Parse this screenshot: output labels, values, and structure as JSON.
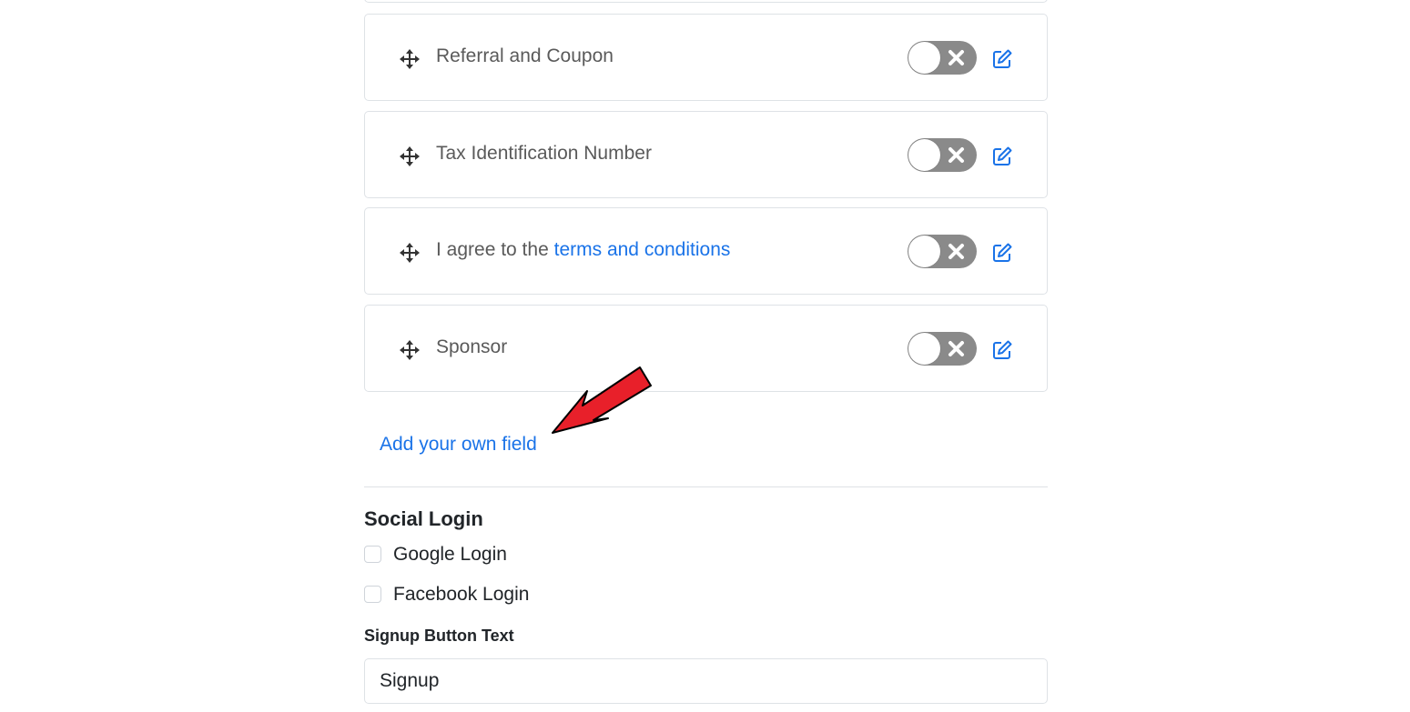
{
  "fields": [
    {
      "label": "Referral and Coupon",
      "enabled": false
    },
    {
      "label": "Tax Identification Number",
      "enabled": false
    },
    {
      "label_prefix": "I agree to the",
      "label_link": "terms and conditions",
      "enabled": false
    },
    {
      "label": "Sponsor",
      "enabled": false
    }
  ],
  "add_field_link": "Add your own field",
  "social_login": {
    "title": "Social Login",
    "options": [
      {
        "label": "Google Login",
        "checked": false
      },
      {
        "label": "Facebook Login",
        "checked": false
      }
    ]
  },
  "signup_button": {
    "label": "Signup Button Text",
    "value": "Signup"
  },
  "colors": {
    "link": "#1a73e8",
    "toggle_off": "#8a8a8a",
    "annotation_arrow": "#e8202a"
  },
  "icons": {
    "drag": "move-icon",
    "toggle_off": "close-icon",
    "edit": "edit-icon"
  }
}
